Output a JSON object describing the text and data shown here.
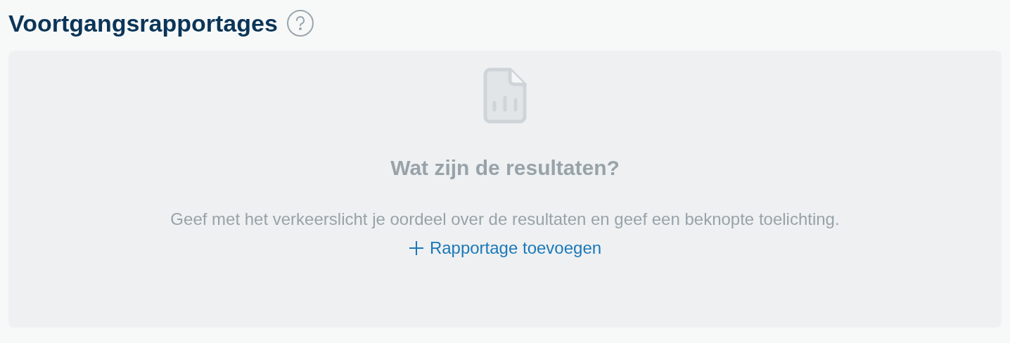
{
  "section": {
    "title": "Voortgangsrapportages"
  },
  "empty_state": {
    "heading": "Wat zijn de resultaten?",
    "description": "Geef met het verkeerslicht je oordeel over de resultaten en geef een beknopte toelichting.",
    "action": "Rapportage toevoegen"
  }
}
